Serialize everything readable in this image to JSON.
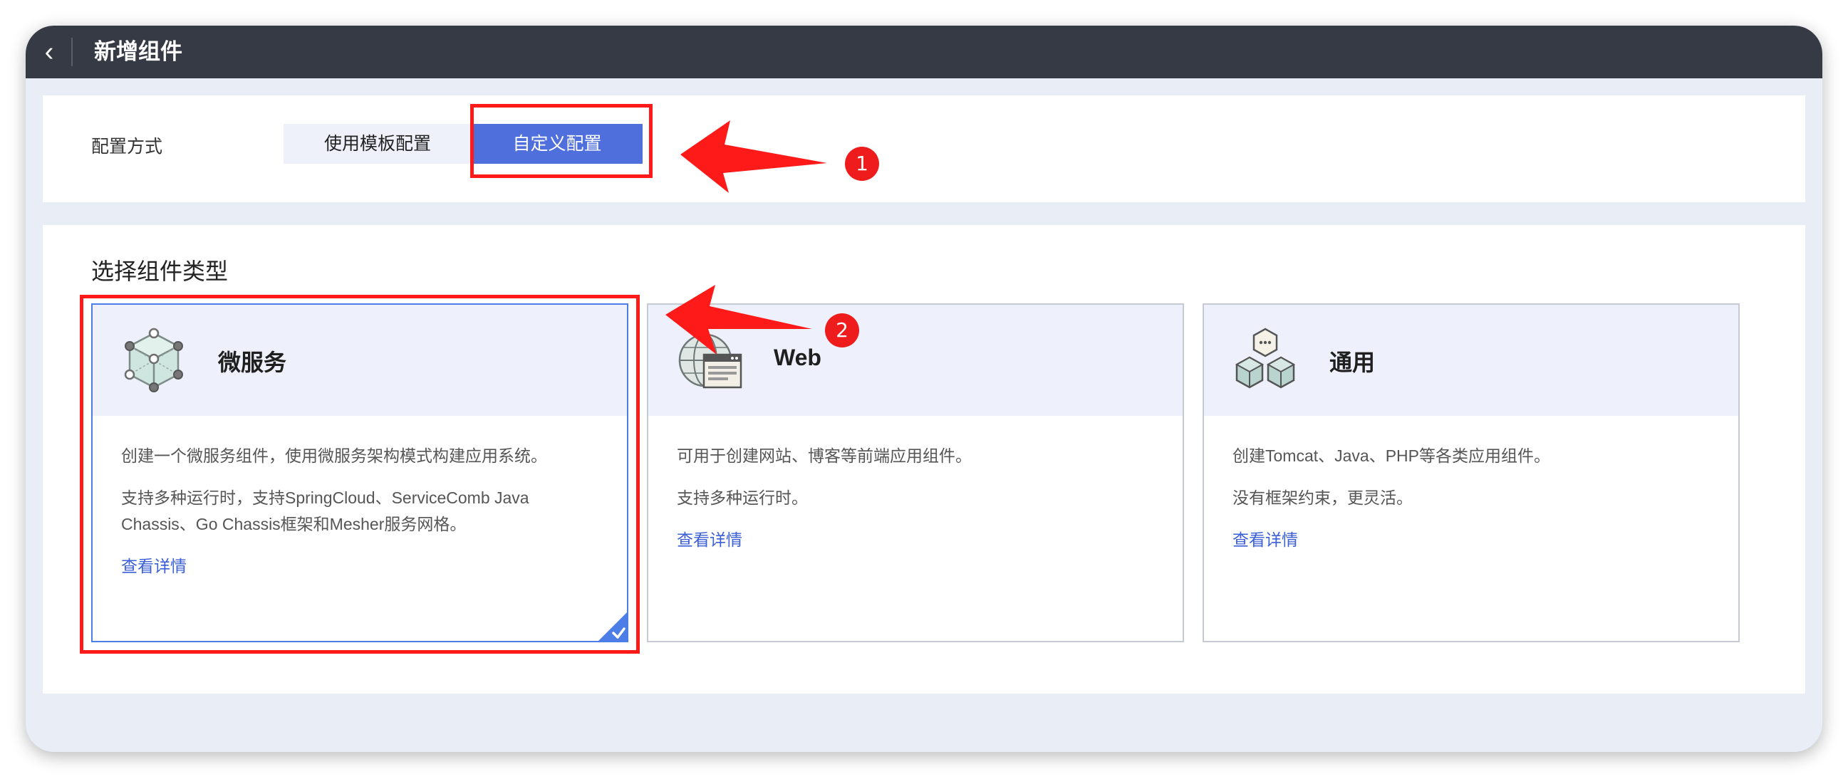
{
  "window": {
    "back_icon": "chevron-left-icon",
    "back_glyph": "‹",
    "title": "新增组件"
  },
  "config": {
    "label": "配置方式",
    "options": [
      "使用模板配置",
      "自定义配置"
    ],
    "selected": "自定义配置"
  },
  "component_type": {
    "title": "选择组件类型",
    "cards": [
      {
        "icon": "microservice-cube-icon",
        "title": "微服务",
        "lines": [
          "创建一个微服务组件，使用微服务架构模式构建应用系统。",
          "支持多种运行时，支持SpringCloud、ServiceComb Java Chassis、Go Chassis框架和Mesher服务网格。"
        ],
        "link": "查看详情",
        "selected": true
      },
      {
        "icon": "web-globe-icon",
        "title": "Web",
        "lines": [
          "可用于创建网站、博客等前端应用组件。",
          "支持多种运行时。"
        ],
        "link": "查看详情",
        "selected": false
      },
      {
        "icon": "generic-cubes-icon",
        "title": "通用",
        "lines": [
          "创建Tomcat、Java、PHP等各类应用组件。",
          "没有框架约束，更灵活。"
        ],
        "link": "查看详情",
        "selected": false
      }
    ]
  },
  "annotations": {
    "badge_1": "1",
    "badge_2": "2",
    "color": "#ff1a1a"
  },
  "colors": {
    "titlebar": "#363a44",
    "accent": "#4f6fdc",
    "link": "#3b5fd6",
    "selected_border": "#4d7ee8"
  }
}
